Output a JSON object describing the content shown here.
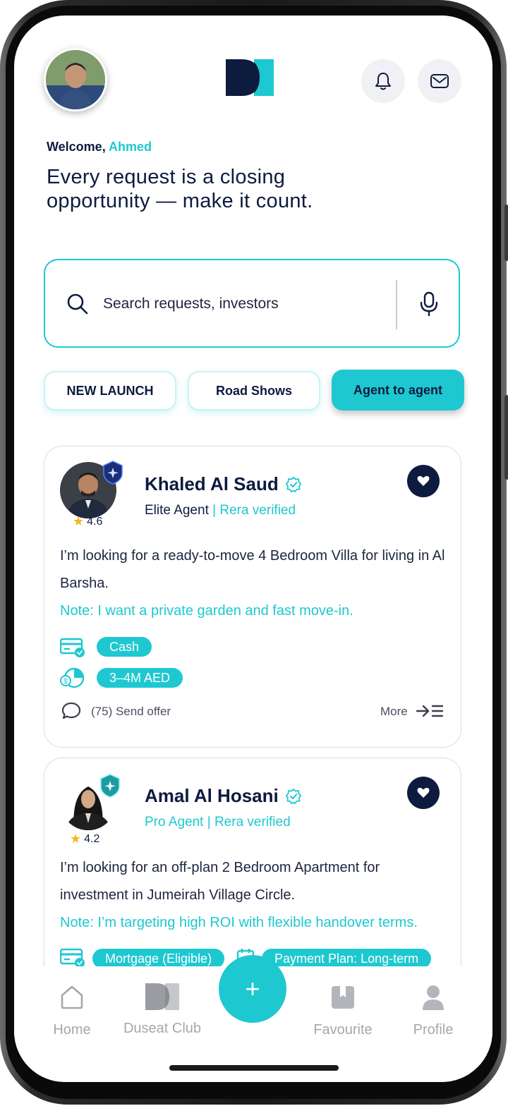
{
  "header": {
    "avatar_icon": "user-avatar",
    "logo_icon": "duseat-logo",
    "notification_icon": "bell-icon",
    "mail_icon": "mail-icon"
  },
  "welcome": {
    "greeting": "Welcome,",
    "user_name": "Ahmed",
    "headline_line1": "Every request is a closing",
    "headline_line2": "opportunity — make it count."
  },
  "search": {
    "placeholder": "Search requests, investors"
  },
  "filters": [
    {
      "label": "NEW LAUNCH",
      "active": false
    },
    {
      "label": "Road Shows",
      "active": false
    },
    {
      "label": "Agent to agent",
      "active": true
    }
  ],
  "cards": [
    {
      "name": "Khaled Al Saud",
      "rating": "4.6",
      "role": "Elite Agent",
      "verified_text": "Rera verified",
      "description": "I’m looking for a ready-to-move 4 Bedroom Villa for living in Al Barsha.",
      "note": "Note: I want a private garden and fast move-in.",
      "payment": "Cash",
      "budget": "3–4M AED",
      "offers": "(75) Send offer",
      "more": "More"
    },
    {
      "name": "Amal Al Hosani",
      "rating": "4.2",
      "role": "Pro Agent",
      "verified_text": "Rera verified",
      "description": "I’m looking for an off-plan 2 Bedroom Apartment for investment in Jumeirah Village Circle.",
      "note": "Note: I’m targeting high ROI with flexible handover terms.",
      "payment": "Mortgage (Eligible)",
      "plan": "Payment Plan: Long-term"
    }
  ],
  "nav": {
    "home": "Home",
    "club": "Duseat Club",
    "fab": "+",
    "favourite": "Favourite",
    "profile": "Profile"
  },
  "colors": {
    "accent": "#1ec8d0",
    "navy": "#0d1b3e",
    "muted": "#a5a7ad"
  }
}
